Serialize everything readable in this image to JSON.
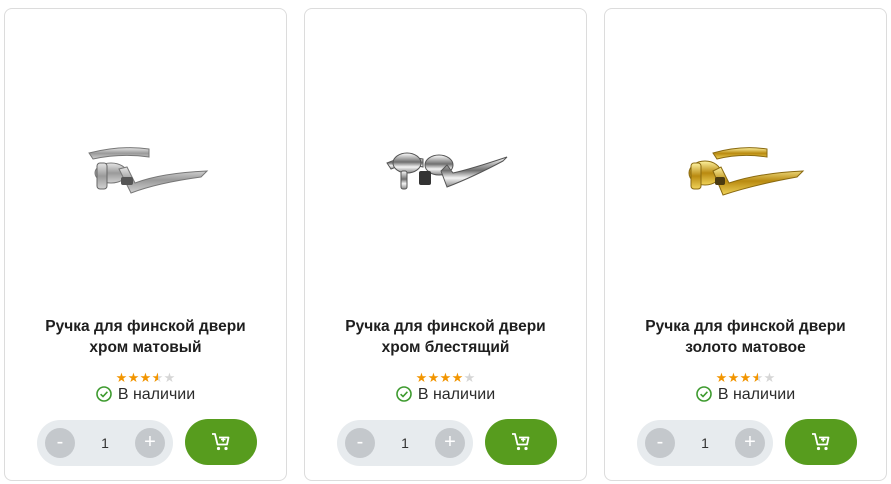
{
  "products": [
    {
      "title_line1": "Ручка для финской двери",
      "title_line2": "хром матовый",
      "rating": 3.5,
      "rating_max": 5,
      "stock": "В наличии",
      "qty": "1",
      "minus": "-",
      "plus": "+",
      "finish": "matte-chrome"
    },
    {
      "title_line1": "Ручка для финской двери",
      "title_line2": "хром блестящий",
      "rating": 4,
      "rating_max": 5,
      "stock": "В наличии",
      "qty": "1",
      "minus": "-",
      "plus": "+",
      "finish": "polished-chrome"
    },
    {
      "title_line1": "Ручка для финской двери",
      "title_line2": "золото матовое",
      "rating": 3.5,
      "rating_max": 5,
      "stock": "В наличии",
      "qty": "1",
      "minus": "-",
      "plus": "+",
      "finish": "matte-gold"
    }
  ],
  "icons": {
    "stock": "check-circle-icon",
    "cart": "cart-icon",
    "star": "star-icon"
  },
  "colors": {
    "accent_green": "#579c1e",
    "star_filled": "#f29500",
    "star_empty": "#d6d6d6",
    "qty_bg": "#e7ebee",
    "qty_btn": "#c4c8cc",
    "check_green": "#3d9a2e"
  }
}
